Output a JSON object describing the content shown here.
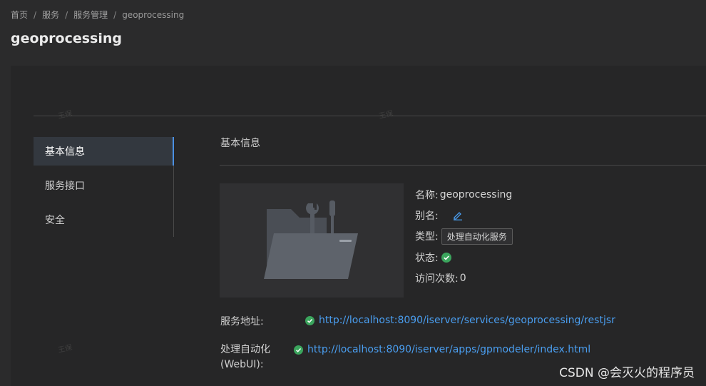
{
  "breadcrumb": {
    "items": [
      "首页",
      "服务",
      "服务管理",
      "geoprocessing"
    ],
    "separator": "/"
  },
  "page": {
    "title": "geoprocessing"
  },
  "side_nav": {
    "items": [
      {
        "label": "基本信息",
        "active": true
      },
      {
        "label": "服务接口",
        "active": false
      },
      {
        "label": "安全",
        "active": false
      }
    ]
  },
  "section": {
    "title": "基本信息"
  },
  "info": {
    "name_label": "名称:",
    "name_value": "geoprocessing",
    "alias_label": "别名:",
    "type_label": "类型:",
    "type_value": "处理自动化服务",
    "status_label": "状态:",
    "visits_label": "访问次数:",
    "visits_value": "0"
  },
  "addresses": {
    "service_label": "服务地址:",
    "service_url": "http://localhost:8090/iserver/services/geoprocessing/restjsr",
    "webui_label_line1": "处理自动化",
    "webui_label_line2": "(WebUI):",
    "webui_url": "http://localhost:8090/iserver/apps/gpmodeler/index.html"
  },
  "watermark_text": "王保",
  "footer_watermark": "CSDN @会灭火的程序员",
  "colors": {
    "background": "#2b2b2c",
    "panel": "#262627",
    "link": "#4a9ef0",
    "status_ok": "#3ba55d",
    "active_nav": "#33383f"
  }
}
